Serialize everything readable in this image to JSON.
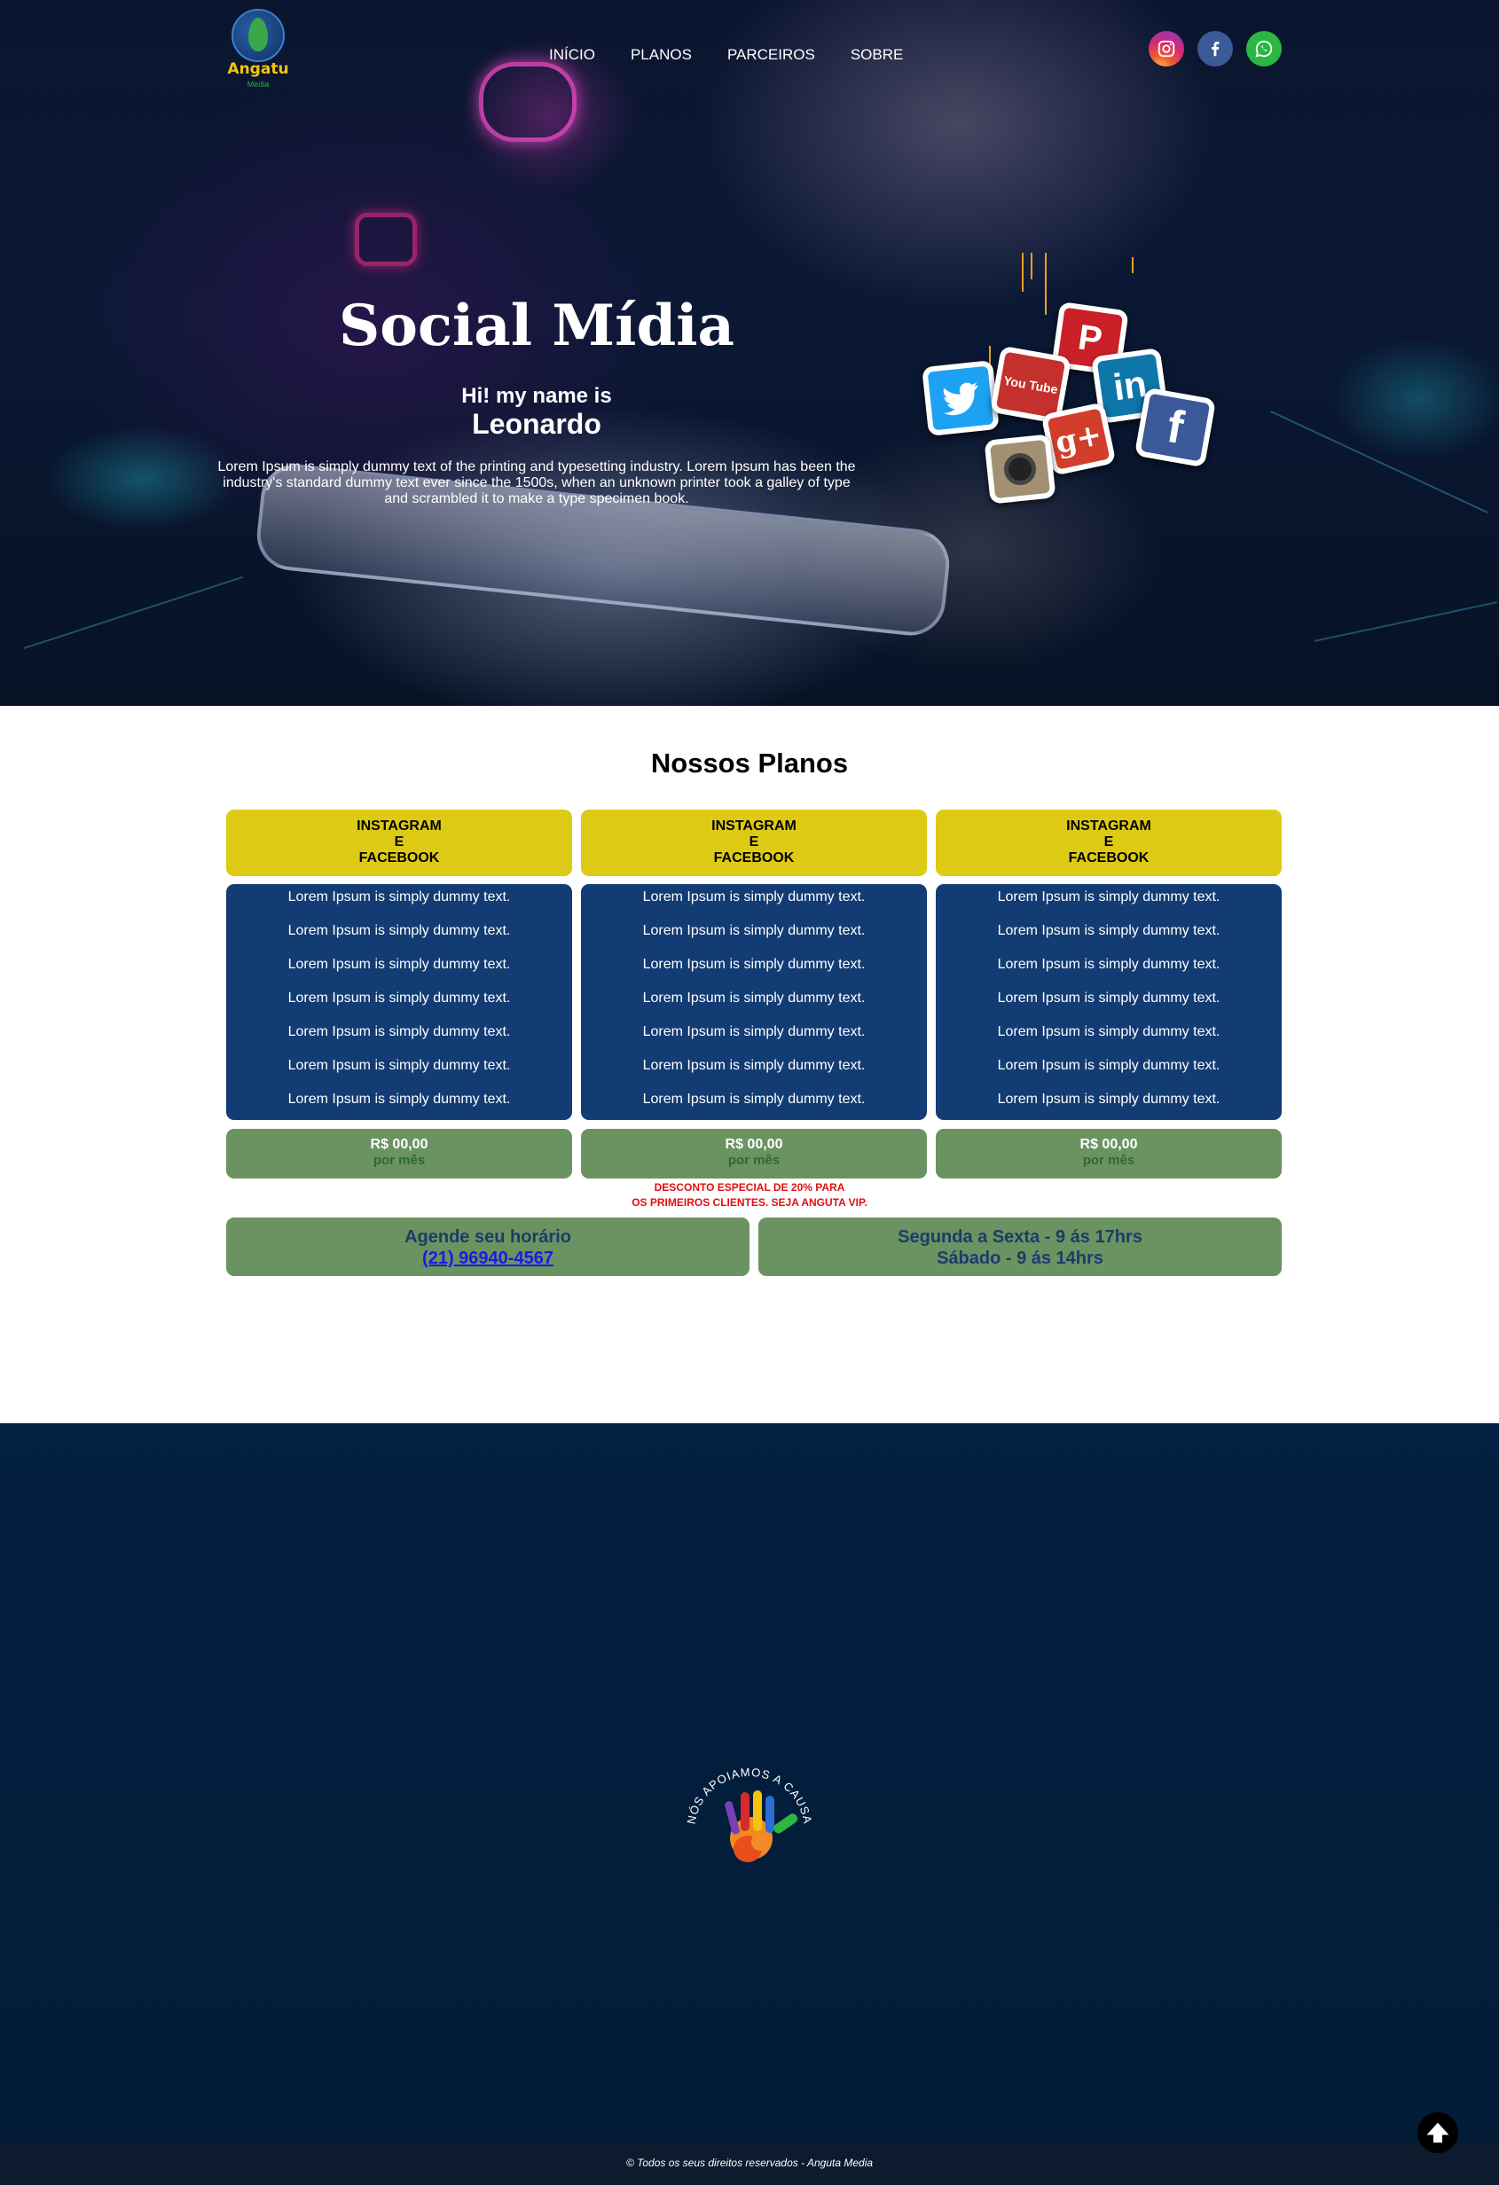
{
  "brand": {
    "name": "Angatu",
    "sub": "Media"
  },
  "nav": [
    "INÍCIO",
    "PLANOS",
    "PARCEIROS",
    "SOBRE"
  ],
  "social": [
    "instagram-icon",
    "facebook-icon",
    "whatsapp-icon"
  ],
  "hero": {
    "title": "Social Mídia",
    "greeting": "Hi! my name is",
    "name": "Leonardo",
    "description": "Lorem Ipsum is simply dummy text of the printing and typesetting industry. Lorem Ipsum has been the industry's standard dummy text ever since the 1500s, when an unknown printer took a galley of type and scrambled it to make a type specimen book."
  },
  "plans": {
    "title": "Nossos Planos",
    "items": [
      {
        "head": [
          "INSTAGRAM",
          "E",
          "FACEBOOK"
        ],
        "features": [
          "Lorem Ipsum is simply dummy text.",
          "Lorem Ipsum is simply dummy text.",
          "Lorem Ipsum is simply dummy text.",
          "Lorem Ipsum is simply dummy text.",
          "Lorem Ipsum is simply dummy text.",
          "Lorem Ipsum is simply dummy text.",
          "Lorem Ipsum is simply dummy text."
        ],
        "price": "R$ 00,00",
        "period": "por mês"
      },
      {
        "head": [
          "INSTAGRAM",
          "E",
          "FACEBOOK"
        ],
        "features": [
          "Lorem Ipsum is simply dummy text.",
          "Lorem Ipsum is simply dummy text.",
          "Lorem Ipsum is simply dummy text.",
          "Lorem Ipsum is simply dummy text.",
          "Lorem Ipsum is simply dummy text.",
          "Lorem Ipsum is simply dummy text.",
          "Lorem Ipsum is simply dummy text."
        ],
        "price": "R$ 00,00",
        "period": "por mês"
      },
      {
        "head": [
          "INSTAGRAM",
          "E",
          "FACEBOOK"
        ],
        "features": [
          "Lorem Ipsum is simply dummy text.",
          "Lorem Ipsum is simply dummy text.",
          "Lorem Ipsum is simply dummy text.",
          "Lorem Ipsum is simply dummy text.",
          "Lorem Ipsum is simply dummy text.",
          "Lorem Ipsum is simply dummy text.",
          "Lorem Ipsum is simply dummy text."
        ],
        "price": "R$ 00,00",
        "period": "por mês"
      }
    ],
    "discount": [
      "DESCONTO ESPECIAL DE 20% PARA",
      "OS PRIMEIROS CLIENTES. SEJA ANGUTA VIP."
    ]
  },
  "contact": {
    "schedule_label": "Agende seu horário",
    "phone": "(21) 96940-4567",
    "hours_week": "Segunda a Sexta - 9 ás 17hrs",
    "hours_sat": "Sábado - 9 ás 14hrs"
  },
  "footer": {
    "cause_text": "NÓS APOIAMOS A CAUSA",
    "copyright": "© Todos os seus direitos reservados - Anguta Media"
  },
  "stickers": [
    {
      "icon": "pinterest-icon",
      "label": "P",
      "color": "#cb2027"
    },
    {
      "icon": "twitter-icon",
      "label": "",
      "color": "#1da1f2"
    },
    {
      "icon": "youtube-icon",
      "label": "You Tube",
      "color": "#c4302b"
    },
    {
      "icon": "linkedin-icon",
      "label": "in",
      "color": "#0e76a8"
    },
    {
      "icon": "googleplus-icon",
      "label": "g+",
      "color": "#d23e2b"
    },
    {
      "icon": "facebook-icon",
      "label": "f",
      "color": "#3b5998"
    },
    {
      "icon": "instagram-icon",
      "label": "",
      "color": "#a38f72"
    }
  ],
  "colors": {
    "plan_head": "#ddca14",
    "plan_body": "#123c73",
    "plan_price": "#6a9361",
    "footer": "#02203f",
    "discount": "#e01010"
  }
}
